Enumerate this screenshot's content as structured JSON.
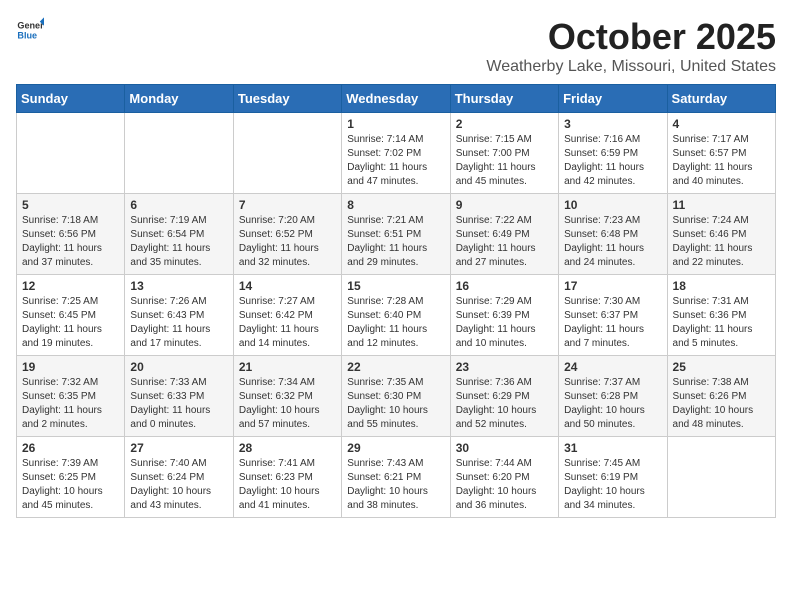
{
  "header": {
    "logo_general": "General",
    "logo_blue": "Blue",
    "month": "October 2025",
    "location": "Weatherby Lake, Missouri, United States"
  },
  "weekdays": [
    "Sunday",
    "Monday",
    "Tuesday",
    "Wednesday",
    "Thursday",
    "Friday",
    "Saturday"
  ],
  "weeks": [
    [
      {
        "day": "",
        "info": ""
      },
      {
        "day": "",
        "info": ""
      },
      {
        "day": "",
        "info": ""
      },
      {
        "day": "1",
        "info": "Sunrise: 7:14 AM\nSunset: 7:02 PM\nDaylight: 11 hours\nand 47 minutes."
      },
      {
        "day": "2",
        "info": "Sunrise: 7:15 AM\nSunset: 7:00 PM\nDaylight: 11 hours\nand 45 minutes."
      },
      {
        "day": "3",
        "info": "Sunrise: 7:16 AM\nSunset: 6:59 PM\nDaylight: 11 hours\nand 42 minutes."
      },
      {
        "day": "4",
        "info": "Sunrise: 7:17 AM\nSunset: 6:57 PM\nDaylight: 11 hours\nand 40 minutes."
      }
    ],
    [
      {
        "day": "5",
        "info": "Sunrise: 7:18 AM\nSunset: 6:56 PM\nDaylight: 11 hours\nand 37 minutes."
      },
      {
        "day": "6",
        "info": "Sunrise: 7:19 AM\nSunset: 6:54 PM\nDaylight: 11 hours\nand 35 minutes."
      },
      {
        "day": "7",
        "info": "Sunrise: 7:20 AM\nSunset: 6:52 PM\nDaylight: 11 hours\nand 32 minutes."
      },
      {
        "day": "8",
        "info": "Sunrise: 7:21 AM\nSunset: 6:51 PM\nDaylight: 11 hours\nand 29 minutes."
      },
      {
        "day": "9",
        "info": "Sunrise: 7:22 AM\nSunset: 6:49 PM\nDaylight: 11 hours\nand 27 minutes."
      },
      {
        "day": "10",
        "info": "Sunrise: 7:23 AM\nSunset: 6:48 PM\nDaylight: 11 hours\nand 24 minutes."
      },
      {
        "day": "11",
        "info": "Sunrise: 7:24 AM\nSunset: 6:46 PM\nDaylight: 11 hours\nand 22 minutes."
      }
    ],
    [
      {
        "day": "12",
        "info": "Sunrise: 7:25 AM\nSunset: 6:45 PM\nDaylight: 11 hours\nand 19 minutes."
      },
      {
        "day": "13",
        "info": "Sunrise: 7:26 AM\nSunset: 6:43 PM\nDaylight: 11 hours\nand 17 minutes."
      },
      {
        "day": "14",
        "info": "Sunrise: 7:27 AM\nSunset: 6:42 PM\nDaylight: 11 hours\nand 14 minutes."
      },
      {
        "day": "15",
        "info": "Sunrise: 7:28 AM\nSunset: 6:40 PM\nDaylight: 11 hours\nand 12 minutes."
      },
      {
        "day": "16",
        "info": "Sunrise: 7:29 AM\nSunset: 6:39 PM\nDaylight: 11 hours\nand 10 minutes."
      },
      {
        "day": "17",
        "info": "Sunrise: 7:30 AM\nSunset: 6:37 PM\nDaylight: 11 hours\nand 7 minutes."
      },
      {
        "day": "18",
        "info": "Sunrise: 7:31 AM\nSunset: 6:36 PM\nDaylight: 11 hours\nand 5 minutes."
      }
    ],
    [
      {
        "day": "19",
        "info": "Sunrise: 7:32 AM\nSunset: 6:35 PM\nDaylight: 11 hours\nand 2 minutes."
      },
      {
        "day": "20",
        "info": "Sunrise: 7:33 AM\nSunset: 6:33 PM\nDaylight: 11 hours\nand 0 minutes."
      },
      {
        "day": "21",
        "info": "Sunrise: 7:34 AM\nSunset: 6:32 PM\nDaylight: 10 hours\nand 57 minutes."
      },
      {
        "day": "22",
        "info": "Sunrise: 7:35 AM\nSunset: 6:30 PM\nDaylight: 10 hours\nand 55 minutes."
      },
      {
        "day": "23",
        "info": "Sunrise: 7:36 AM\nSunset: 6:29 PM\nDaylight: 10 hours\nand 52 minutes."
      },
      {
        "day": "24",
        "info": "Sunrise: 7:37 AM\nSunset: 6:28 PM\nDaylight: 10 hours\nand 50 minutes."
      },
      {
        "day": "25",
        "info": "Sunrise: 7:38 AM\nSunset: 6:26 PM\nDaylight: 10 hours\nand 48 minutes."
      }
    ],
    [
      {
        "day": "26",
        "info": "Sunrise: 7:39 AM\nSunset: 6:25 PM\nDaylight: 10 hours\nand 45 minutes."
      },
      {
        "day": "27",
        "info": "Sunrise: 7:40 AM\nSunset: 6:24 PM\nDaylight: 10 hours\nand 43 minutes."
      },
      {
        "day": "28",
        "info": "Sunrise: 7:41 AM\nSunset: 6:23 PM\nDaylight: 10 hours\nand 41 minutes."
      },
      {
        "day": "29",
        "info": "Sunrise: 7:43 AM\nSunset: 6:21 PM\nDaylight: 10 hours\nand 38 minutes."
      },
      {
        "day": "30",
        "info": "Sunrise: 7:44 AM\nSunset: 6:20 PM\nDaylight: 10 hours\nand 36 minutes."
      },
      {
        "day": "31",
        "info": "Sunrise: 7:45 AM\nSunset: 6:19 PM\nDaylight: 10 hours\nand 34 minutes."
      },
      {
        "day": "",
        "info": ""
      }
    ]
  ]
}
